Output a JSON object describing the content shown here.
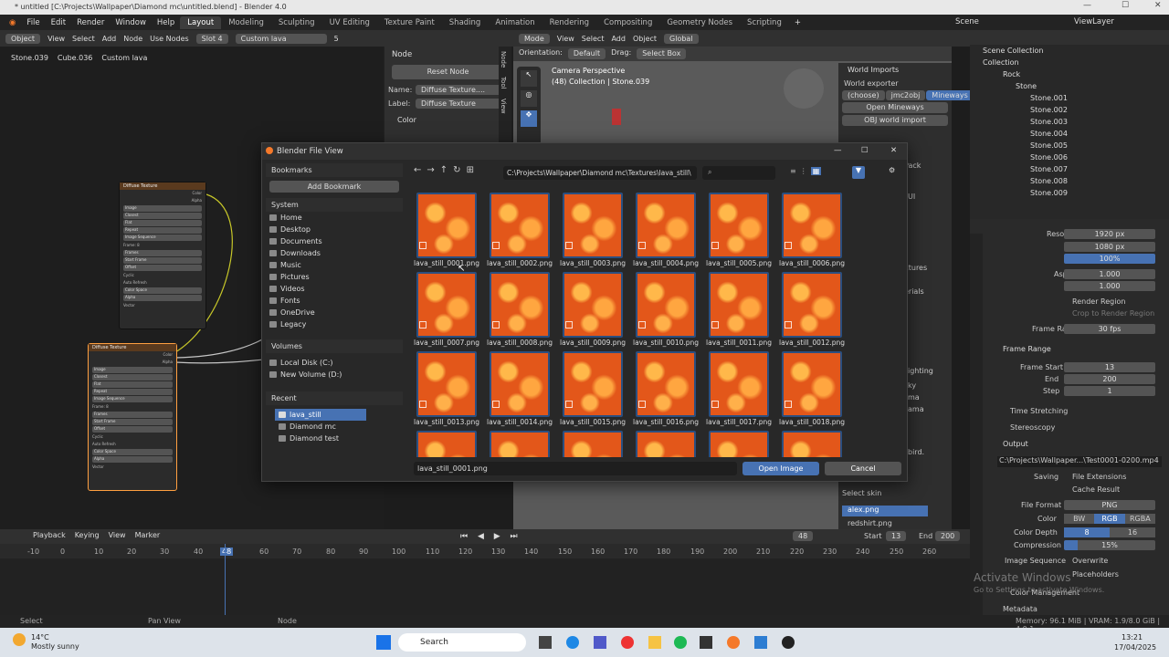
{
  "window": {
    "title": "* untitled [C:\\Projects\\Wallpaper\\Diamond mc\\untitled.blend] - Blender 4.0"
  },
  "menu": {
    "items": [
      "File",
      "Edit",
      "Render",
      "Window",
      "Help"
    ],
    "workspaces": [
      "Layout",
      "Modeling",
      "Sculpting",
      "UV Editing",
      "Texture Paint",
      "Shading",
      "Animation",
      "Rendering",
      "Compositing",
      "Geometry Nodes",
      "Scripting"
    ],
    "scene": "Scene",
    "view_layer": "ViewLayer"
  },
  "node_header": {
    "object": "Object",
    "view": "View",
    "select": "Select",
    "add": "Add",
    "node": "Node",
    "use_nodes": "Use Nodes",
    "slot": "Slot 4",
    "material": "Custom lava",
    "users": "5"
  },
  "breadcrumb": {
    "obj": "Stone.039",
    "mesh": "Cube.036",
    "mat": "Custom lava"
  },
  "node_panel": {
    "title": "Node",
    "reset": "Reset Node",
    "name_label": "Name:",
    "name_value": "Diffuse Texture....",
    "label_label": "Label:",
    "label_value": "Diffuse Texture",
    "color": "Color",
    "tabs": [
      "Node",
      "Tool",
      "View"
    ]
  },
  "viewport": {
    "mode": "Mode",
    "view": "View",
    "select": "Select",
    "add": "Add",
    "object": "Object",
    "orientation_label": "Orientation:",
    "orientation": "Default",
    "drag_label": "Drag:",
    "drag": "Select Box",
    "transform": "Global",
    "camera": "Camera Perspective",
    "collection": "(48) Collection | Stone.039"
  },
  "world_imports": {
    "title": "World Imports",
    "exporter": "World exporter",
    "choose": "(choose)",
    "jmc": "jmc2obj",
    "mineways": "Mineways",
    "open": "Open Mineways",
    "obj": "OBJ world import",
    "select_skin": "Select skin",
    "skin": "alex.png",
    "skin2": "redshirt.png",
    "frag": [
      "Pack",
      "xtures",
      "erials",
      "ighting",
      "ky",
      "ma",
      "ama",
      "bird.",
      "UI"
    ]
  },
  "outliner": {
    "scene_collection": "Scene Collection",
    "collection": "Collection",
    "rock": "Rock",
    "stones": [
      "Stone",
      "Stone.001",
      "Stone.002",
      "Stone.003",
      "Stone.004",
      "Stone.005",
      "Stone.006",
      "Stone.007",
      "Stone.008",
      "Stone.009"
    ]
  },
  "props": {
    "res_x": "Resolution X",
    "res_x_val": "1920 px",
    "y": "Y",
    "y_val": "1080 px",
    "pct": "%",
    "pct_val": "100%",
    "aspect_x": "Aspect X",
    "aspect_x_val": "1.000",
    "aspect_y": "Y",
    "aspect_y_val": "1.000",
    "render_region": "Render Region",
    "crop": "Crop to Render Region",
    "frame_rate": "Frame Rate",
    "frame_rate_val": "30 fps",
    "frame_range": "Frame Range",
    "frame_start": "Frame Start",
    "frame_start_val": "13",
    "end": "End",
    "end_val": "200",
    "step": "Step",
    "step_val": "1",
    "time_stretching": "Time Stretching",
    "stereoscopy": "Stereoscopy",
    "output": "Output",
    "output_path": "C:\\Projects\\Wallpaper...\\Test0001-0200.mp4",
    "saving": "Saving",
    "file_ext": "File Extensions",
    "cache": "Cache Result",
    "file_format": "File Format",
    "file_format_val": "PNG",
    "color": "Color",
    "bw": "BW",
    "rgb": "RGB",
    "rgba": "RGBA",
    "color_depth": "Color Depth",
    "depth8": "8",
    "depth16": "16",
    "compression": "Compression",
    "compression_val": "15%",
    "image_seq": "Image Sequence",
    "overwrite": "Overwrite",
    "placeholders": "Placeholders",
    "color_mgmt": "Color Management",
    "metadata": "Metadata",
    "activate1": "Activate Windows",
    "activate2": "Go to Settings to activate Windows."
  },
  "nodes": {
    "title": "Diffuse Texture",
    "color": "Color",
    "alpha": "Alpha",
    "image": "Image",
    "closest": "Closest",
    "flat": "Flat",
    "repeat": "Repeat",
    "img_seq": "Image Sequence",
    "frames": "Frames",
    "frames_val1": "20",
    "frames_val2": "40",
    "start": "Start Frame",
    "offset": "Offset",
    "cyclic": "Cyclic",
    "auto": "Auto Refresh",
    "colorspace": "Color Space",
    "srgb": "sRGB",
    "alpha2": "Alpha",
    "straight": "Straight",
    "vector": "Vector",
    "frame_label": "Frame: 8"
  },
  "timeline": {
    "playback": "Playback",
    "keying": "Keying",
    "view": "View",
    "marker": "Marker",
    "current": "48",
    "start_label": "Start",
    "start": "13",
    "end_label": "End",
    "end": "200",
    "ticks": [
      "-10",
      "0",
      "10",
      "20",
      "30",
      "40",
      "48",
      "60",
      "70",
      "80",
      "90",
      "100",
      "110",
      "120",
      "130",
      "140",
      "150",
      "160",
      "170",
      "180",
      "190",
      "200",
      "210",
      "220",
      "230",
      "240",
      "250",
      "260"
    ]
  },
  "status": {
    "select": "Select",
    "pan": "Pan View",
    "node": "Node",
    "memory": "Memory: 96.1 MiB | VRAM: 1.9/8.0 GiB | 4.0.1"
  },
  "taskbar": {
    "temp": "14°C",
    "weather": "Mostly sunny",
    "search": "Search",
    "time": "13:21",
    "date": "17/04/2025"
  },
  "dialog": {
    "title": "Blender File View",
    "path": "C:\\Projects\\Wallpaper\\Diamond mc\\Textures\\lava_still\\",
    "bookmarks": "Bookmarks",
    "add_bookmark": "Add Bookmark",
    "system": "System",
    "system_items": [
      "Home",
      "Desktop",
      "Documents",
      "Downloads",
      "Music",
      "Pictures",
      "Videos",
      "Fonts",
      "OneDrive",
      "Legacy"
    ],
    "volumes": "Volumes",
    "volume_items": [
      "Local Disk (C:)",
      "New Volume (D:)"
    ],
    "recent": "Recent",
    "recent_items": [
      "lava_still",
      "Diamond mc",
      "Diamond test"
    ],
    "files": [
      "lava_still_0001.png",
      "lava_still_0002.png",
      "lava_still_0003.png",
      "lava_still_0004.png",
      "lava_still_0005.png",
      "lava_still_0006.png",
      "lava_still_0007.png",
      "lava_still_0008.png",
      "lava_still_0009.png",
      "lava_still_0010.png",
      "lava_still_0011.png",
      "lava_still_0012.png",
      "lava_still_0013.png",
      "lava_still_0014.png",
      "lava_still_0015.png",
      "lava_still_0016.png",
      "lava_still_0017.png",
      "lava_still_0018.png",
      "",
      "",
      "",
      "",
      "",
      ""
    ],
    "filename": "lava_still_0001.png",
    "open": "Open Image",
    "cancel": "Cancel"
  }
}
